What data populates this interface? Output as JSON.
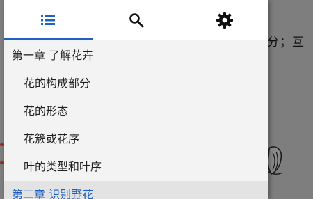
{
  "background_page": {
    "partial_text": "分；互"
  },
  "drawer": {
    "tabs": [
      {
        "icon": "list-icon",
        "active": true
      },
      {
        "icon": "search-icon",
        "active": false
      },
      {
        "icon": "gear-icon",
        "active": false
      }
    ],
    "accent_color": "#1e63c4",
    "toc": [
      {
        "label": "第一章 了解花卉",
        "level": 1
      },
      {
        "label": "花的构成部分",
        "level": 2
      },
      {
        "label": "花的形态",
        "level": 2
      },
      {
        "label": "花簇或花序",
        "level": 2
      },
      {
        "label": "叶的类型和叶序",
        "level": 2
      },
      {
        "label": "第二章 识别野花",
        "level": 1,
        "current": true
      }
    ]
  }
}
